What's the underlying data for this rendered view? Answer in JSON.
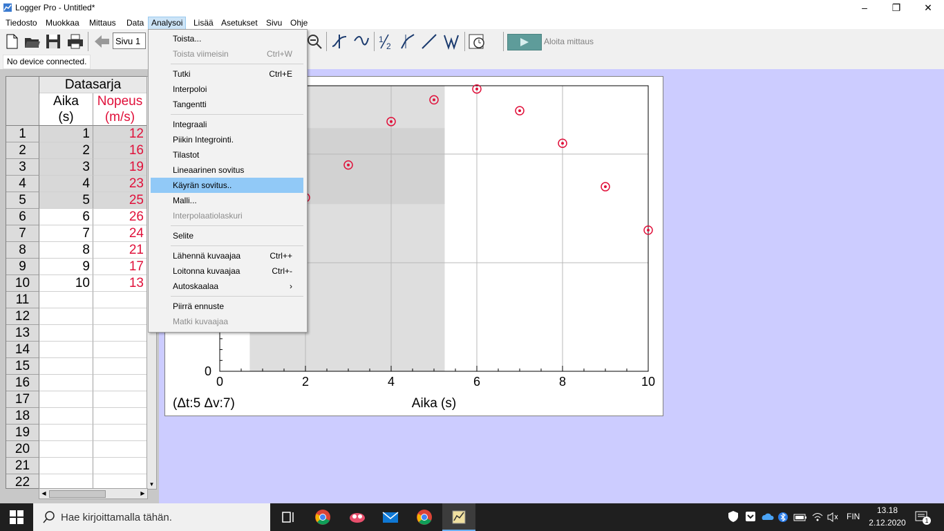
{
  "window": {
    "title": "Logger Pro - Untitled*"
  },
  "menubar": [
    "Tiedosto",
    "Muokkaa",
    "Mittaus",
    "Data",
    "Analysoi",
    "Lisää",
    "Asetukset",
    "Sivu",
    "Ohje"
  ],
  "toolbar": {
    "page_value": "Sivu 1",
    "start_label": "Aloita mittaus"
  },
  "status": {
    "device": "No device connected."
  },
  "table": {
    "title": "Datasarja",
    "col_aika_name": "Aika",
    "col_aika_unit": "(s)",
    "col_nopeus_name": "Nopeus",
    "col_nopeus_unit": "(m/s)",
    "row_numbers": [
      "1",
      "2",
      "3",
      "4",
      "5",
      "6",
      "7",
      "8",
      "9",
      "10",
      "11",
      "12",
      "13",
      "14",
      "15",
      "16",
      "17",
      "18",
      "19",
      "20",
      "21",
      "22"
    ],
    "aika": [
      "1",
      "2",
      "3",
      "4",
      "5",
      "6",
      "7",
      "8",
      "9",
      "10"
    ],
    "nopeus": [
      "12",
      "16",
      "19",
      "23",
      "25",
      "26",
      "24",
      "21",
      "17",
      "13"
    ]
  },
  "graph": {
    "xlabel": "Aika (s)",
    "x_ticks": [
      "0",
      "2",
      "4",
      "6",
      "8",
      "10"
    ],
    "y_zero": "0",
    "delta_readout": "(Δt:5 Δv:7)",
    "selection_x": [
      0.7,
      5.25
    ]
  },
  "chart_data": {
    "type": "scatter",
    "x": [
      1,
      2,
      3,
      4,
      5,
      6,
      7,
      8,
      9,
      10
    ],
    "y": [
      12,
      16,
      19,
      23,
      25,
      26,
      24,
      21,
      17,
      13
    ],
    "xlabel": "Aika (s)",
    "xlim": [
      0,
      10
    ],
    "grid": true,
    "marker_color": "#e0103a"
  },
  "dropdown": {
    "items": [
      {
        "label": "Toista...",
        "shortcut": "",
        "disabled": false
      },
      {
        "label": "Toista viimeisin",
        "shortcut": "Ctrl+W",
        "disabled": true
      },
      {
        "label": "Tutki",
        "shortcut": "Ctrl+E",
        "disabled": false
      },
      {
        "label": "Interpoloi",
        "shortcut": "",
        "disabled": false
      },
      {
        "label": "Tangentti",
        "shortcut": "",
        "disabled": false
      },
      {
        "label": "Integraali",
        "shortcut": "",
        "disabled": false
      },
      {
        "label": "Piikin Integrointi.",
        "shortcut": "",
        "disabled": false
      },
      {
        "label": "Tilastot",
        "shortcut": "",
        "disabled": false
      },
      {
        "label": "Lineaarinen sovitus",
        "shortcut": "",
        "disabled": false
      },
      {
        "label": "Käyrän sovitus..",
        "shortcut": "",
        "disabled": false,
        "highlighted": true
      },
      {
        "label": "Malli...",
        "shortcut": "",
        "disabled": false
      },
      {
        "label": "Interpolaatiolaskuri",
        "shortcut": "",
        "disabled": true
      },
      {
        "label": "Selite",
        "shortcut": "",
        "disabled": false
      },
      {
        "label": "Lähennä kuvaajaa",
        "shortcut": "Ctrl++",
        "disabled": false
      },
      {
        "label": "Loitonna kuvaajaa",
        "shortcut": "Ctrl+-",
        "disabled": false
      },
      {
        "label": "Autoskaalaa",
        "shortcut": "›",
        "disabled": false
      },
      {
        "label": "Piirrä ennuste",
        "shortcut": "",
        "disabled": false
      },
      {
        "label": "Matki kuvaajaa",
        "shortcut": "",
        "disabled": true
      }
    ]
  },
  "taskbar": {
    "search_placeholder": "Hae kirjoittamalla tähän.",
    "language": "FIN",
    "time": "13.18",
    "date": "2.12.2020",
    "notification_count": "1"
  }
}
